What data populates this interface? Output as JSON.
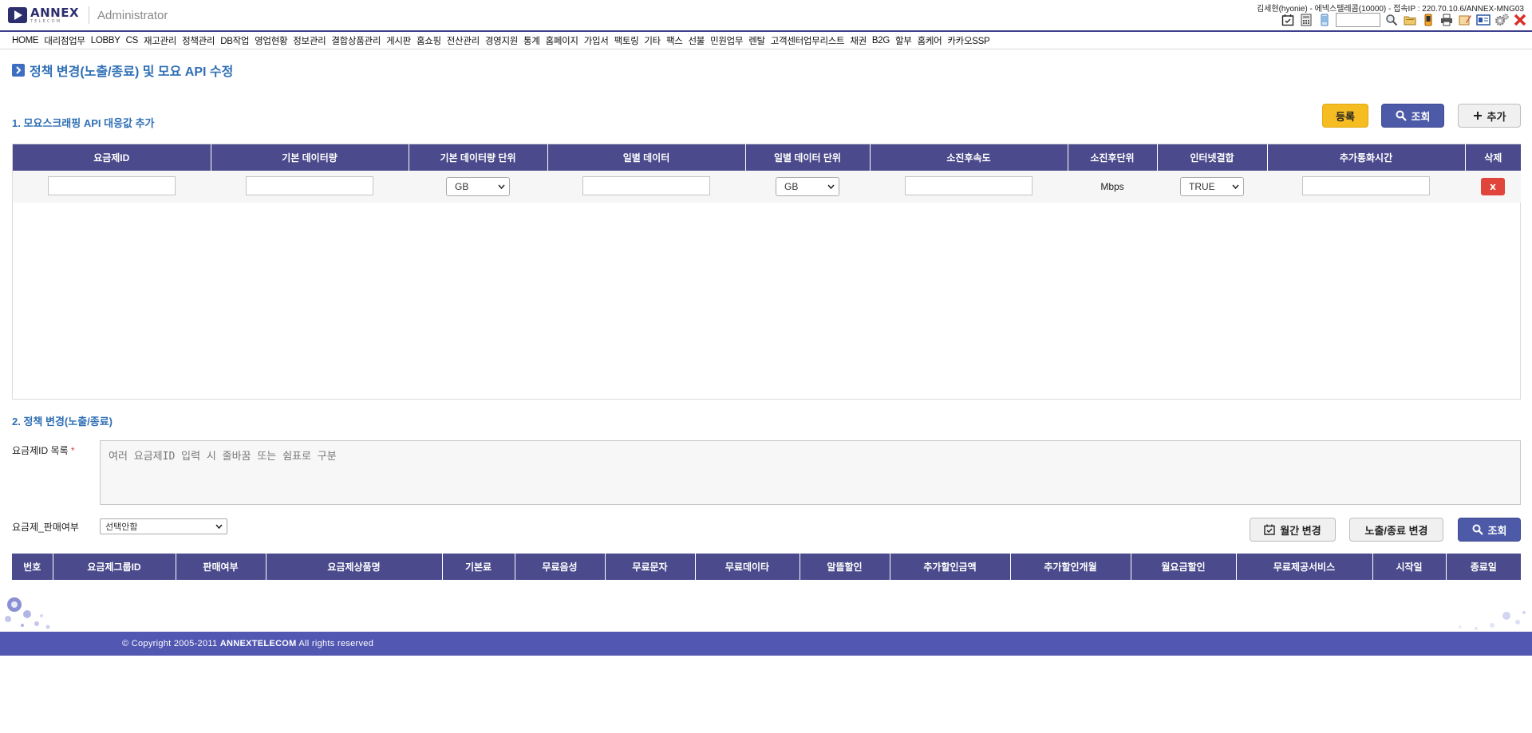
{
  "header": {
    "logo_text": "ANNEX",
    "logo_sub": "TELECOM",
    "admin_label": "Administrator",
    "user_info": "김세현(hyonie) - 에넥스텔레콤(10000) - 접속IP : 220.70.10.6/ANNEX-MNG03",
    "icons": [
      "calendar-check-icon",
      "calculator-icon",
      "phone-icon",
      "search-input",
      "search-icon",
      "folder-icon",
      "mobile-icon",
      "printer-icon",
      "edit-icon",
      "card-icon",
      "settings-icon",
      "close-icon"
    ]
  },
  "nav": {
    "items": [
      "HOME",
      "대리점업무",
      "LOBBY",
      "CS",
      "재고관리",
      "정책관리",
      "DB작업",
      "영업현황",
      "정보관리",
      "결합상품관리",
      "게시판",
      "홈쇼핑",
      "전산관리",
      "경영지원",
      "통계",
      "홈페이지",
      "가입서",
      "팩토링",
      "기타",
      "팩스",
      "선불",
      "민원업무",
      "렌탈",
      "고객센터업무리스트",
      "채권",
      "B2G",
      "할부",
      "홈케어",
      "카카오SSP"
    ]
  },
  "page": {
    "title": "정책 변경(노출/종료) 및 모요 API 수정"
  },
  "section1": {
    "title": "1. 모요스크래핑 API 대응값 추가",
    "btn_register": "등록",
    "btn_search": "조회",
    "btn_add": "추가",
    "columns": [
      "요금제ID",
      "기본 데이터량",
      "기본 데이터량 단위",
      "일별 데이터",
      "일별 데이터 단위",
      "소진후속도",
      "소진후단위",
      "인터넷결합",
      "추가통화시간",
      "삭제"
    ],
    "row": {
      "base_unit": "GB",
      "daily_unit": "GB",
      "after_unit": "Mbps",
      "internet_bundle": "TRUE",
      "delete_label": "x"
    }
  },
  "section2": {
    "title": "2. 정책 변경(노출/종료)",
    "plan_id_label": "요금제ID 목록",
    "required_mark": "*",
    "plan_id_placeholder": "여러 요금제ID 입력 시 줄바꿈 또는 쉼표로 구분",
    "sale_label": "요금제_판매여부",
    "sale_value": "선택안함",
    "btn_monthly": "월간 변경",
    "btn_expose": "노출/종료 변경",
    "btn_search": "조회",
    "columns": [
      "번호",
      "요금제그룹ID",
      "판매여부",
      "요금제상품명",
      "기본료",
      "무료음성",
      "무료문자",
      "무료데이타",
      "알뜰할인",
      "추가할인금액",
      "추가할인개월",
      "월요금할인",
      "무료제공서비스",
      "시작일",
      "종료일"
    ]
  },
  "footer": {
    "copyright_prefix": "© Copyright 2005-2011",
    "company": "ANNEXTELECOM",
    "copyright_suffix": "All rights reserved"
  }
}
